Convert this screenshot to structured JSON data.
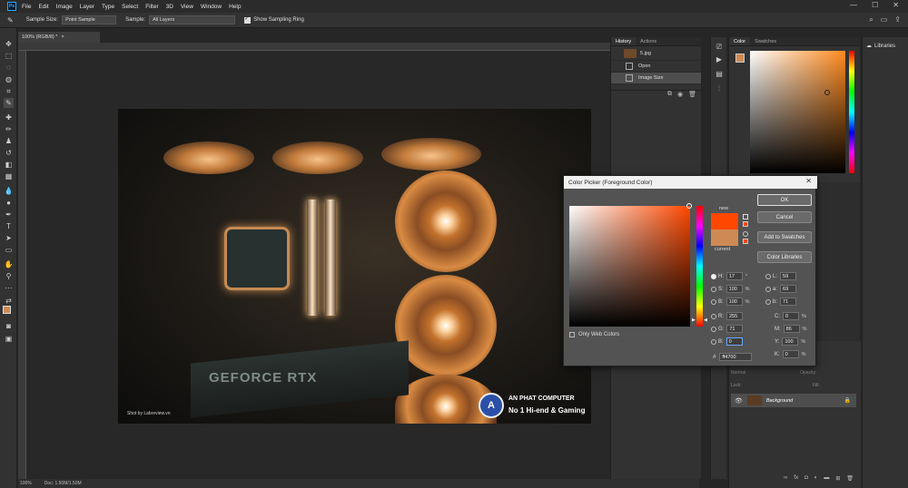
{
  "menubar": {
    "logo": "Ps",
    "items": [
      "File",
      "Edit",
      "Image",
      "Layer",
      "Type",
      "Select",
      "Filter",
      "3D",
      "View",
      "Window",
      "Help"
    ],
    "win_controls": [
      "—",
      "☐",
      "✕"
    ]
  },
  "options": {
    "sample_size_label": "Sample Size:",
    "sample_size_value": "Point Sample",
    "sample_label": "Sample:",
    "sample_value": "All Layers",
    "show_ring_label": "Show Sampling Ring"
  },
  "document": {
    "tab_title": "100% (RGB/8) *",
    "tab_close": "×",
    "status_zoom": "100%",
    "status_doc": "Doc: 1.50M/1.50M"
  },
  "photo": {
    "gpu_text": "GEFORCE RTX",
    "credit": "Shot by Labreview.vn",
    "brand_logo": "A",
    "brand_title": "AN PHAT COMPUTER",
    "brand_sub": "No 1 Hi-end & Gaming"
  },
  "history": {
    "tabs": [
      "History",
      "Actions"
    ],
    "snapshot": "5.jpg",
    "items": [
      "Open",
      "Image Size"
    ]
  },
  "color_panel": {
    "tabs": [
      "Color",
      "Swatches"
    ]
  },
  "layers": {
    "mode": "Normal",
    "opacity": "Opacity:",
    "lock": "Lock:",
    "fill": "Fill:",
    "layer_name": "Background"
  },
  "libraries": {
    "label": "Libraries"
  },
  "dialog": {
    "title": "Color Picker (Foreground Color)",
    "close": "✕",
    "new_label": "new",
    "current_label": "current",
    "buttons": {
      "ok": "OK",
      "cancel": "Cancel",
      "add_swatches": "Add to Swatches",
      "color_libraries": "Color Libraries"
    },
    "hsb": {
      "h": "17",
      "h_unit": "°",
      "s": "100",
      "s_unit": "%",
      "b": "100",
      "b_unit": "%"
    },
    "rgb": {
      "r": "255",
      "g": "71",
      "b": "0"
    },
    "lab": {
      "l": "59",
      "a": "69",
      "b": "71"
    },
    "cmyk": {
      "c": "0",
      "m": "86",
      "y": "100",
      "k": "0",
      "unit": "%"
    },
    "labels": {
      "H": "H:",
      "S": "S:",
      "B": "B:",
      "R": "R:",
      "G": "G:",
      "Bb": "B:",
      "L": "L:",
      "a": "a:",
      "bb": "b:",
      "C": "C:",
      "M": "M:",
      "Y": "Y:",
      "K": "K:"
    },
    "only_web": "Only Web Colors",
    "hex_label": "#",
    "hex": "ff4700"
  },
  "colors": {
    "new": "#ff4700",
    "current": "#ce8a54",
    "panel_fg": "#ce8a54"
  }
}
